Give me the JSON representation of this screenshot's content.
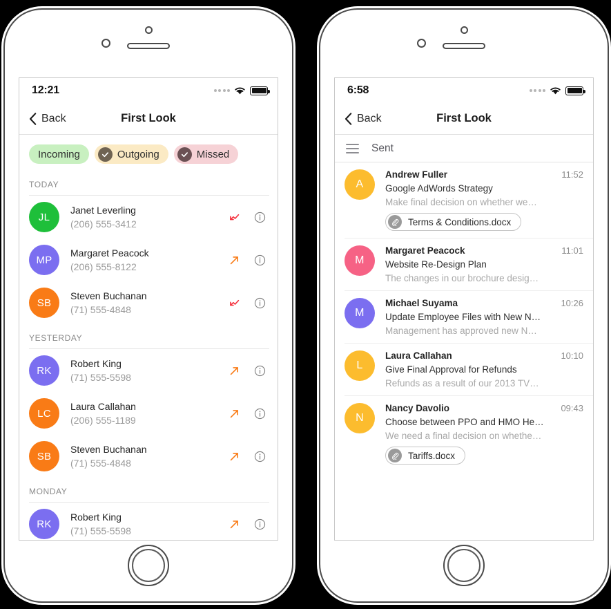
{
  "colors": {
    "green": "#1ebf3a",
    "purple": "#7b6ef0",
    "orange": "#f97b16",
    "amber": "#fcbc2e",
    "pink": "#f66285",
    "missed_arrow": "#f5333f",
    "outgoing_arrow": "#f97b16",
    "chip_incoming_bg": "#c8f0c0",
    "chip_outgoing_bg": "#fbeac4",
    "chip_missed_bg": "#f6d2d6",
    "chip_outgoing_tick": "#6f6352",
    "chip_missed_tick": "#6b5154"
  },
  "left_phone": {
    "status": {
      "time": "12:21",
      "signal": "signal-dots",
      "wifi": "wifi-icon",
      "battery": "battery-icon"
    },
    "nav": {
      "back": "Back",
      "title": "First Look"
    },
    "filters": [
      {
        "label": "Incoming",
        "checked": false
      },
      {
        "label": "Outgoing",
        "checked": true
      },
      {
        "label": "Missed",
        "checked": true
      }
    ],
    "sections": [
      {
        "title": "TODAY",
        "calls": [
          {
            "initials": "JL",
            "color": "green",
            "name": "Janet Leverling",
            "phone": "(206) 555-3412",
            "direction": "missed"
          },
          {
            "initials": "MP",
            "color": "purple",
            "name": "Margaret Peacock",
            "phone": "(206) 555-8122",
            "direction": "outgoing"
          },
          {
            "initials": "SB",
            "color": "orange",
            "name": "Steven Buchanan",
            "phone": "(71) 555-4848",
            "direction": "missed"
          }
        ]
      },
      {
        "title": "YESTERDAY",
        "calls": [
          {
            "initials": "RK",
            "color": "purple",
            "name": "Robert King",
            "phone": "(71) 555-5598",
            "direction": "outgoing"
          },
          {
            "initials": "LC",
            "color": "orange",
            "name": "Laura Callahan",
            "phone": "(206) 555-1189",
            "direction": "outgoing"
          },
          {
            "initials": "SB",
            "color": "orange",
            "name": "Steven Buchanan",
            "phone": "(71) 555-4848",
            "direction": "outgoing"
          }
        ]
      },
      {
        "title": "MONDAY",
        "calls": [
          {
            "initials": "RK",
            "color": "purple",
            "name": "Robert King",
            "phone": "(71) 555-5598",
            "direction": "outgoing"
          }
        ]
      }
    ]
  },
  "right_phone": {
    "status": {
      "time": "6:58",
      "signal": "signal-dots",
      "wifi": "wifi-icon",
      "battery": "battery-icon"
    },
    "nav": {
      "back": "Back",
      "title": "First Look"
    },
    "folder": {
      "menu_icon": "hamburger-icon",
      "label": "Sent"
    },
    "emails": [
      {
        "initial": "A",
        "color": "amber",
        "sender": "Andrew Fuller",
        "time": "11:52",
        "subject": "Google AdWords Strategy",
        "preview": "Make final decision on whether we…",
        "attachment": "Terms & Conditions.docx"
      },
      {
        "initial": "M",
        "color": "pink",
        "sender": "Margaret Peacock",
        "time": "11:01",
        "subject": "Website Re-Design Plan",
        "preview": "The changes in our brochure desig…",
        "attachment": null
      },
      {
        "initial": "M",
        "color": "purple",
        "sender": "Michael Suyama",
        "time": "10:26",
        "subject": "Update Employee Files with New N…",
        "preview": "Management has approved new N…",
        "attachment": null
      },
      {
        "initial": "L",
        "color": "amber",
        "sender": "Laura Callahan",
        "time": "10:10",
        "subject": "Give Final Approval for Refunds",
        "preview": "Refunds as a result of our 2013 TV…",
        "attachment": null
      },
      {
        "initial": "N",
        "color": "amber",
        "sender": "Nancy Davolio",
        "time": "09:43",
        "subject": "Choose between PPO and HMO He…",
        "preview": "We need a final decision on whethe…",
        "attachment": "Tariffs.docx"
      }
    ]
  }
}
